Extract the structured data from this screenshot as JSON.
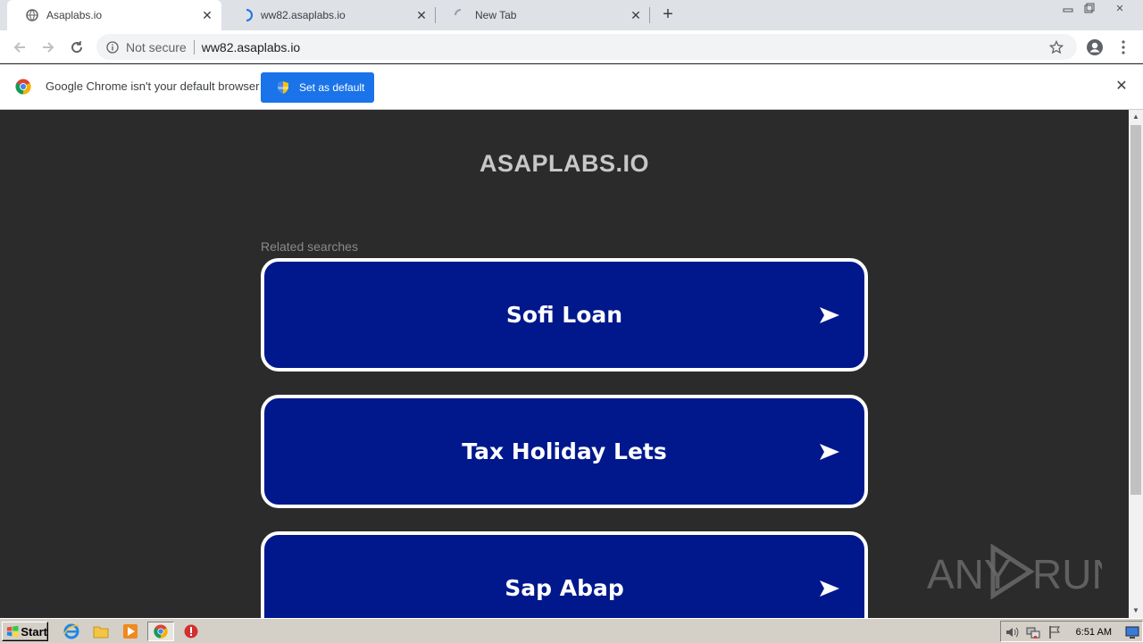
{
  "browser": {
    "tabs": [
      {
        "title": "Asaplabs.io",
        "active": true,
        "favicon": "globe-icon"
      },
      {
        "title": "ww82.asaplabs.io",
        "active": false,
        "favicon": "loading-icon"
      },
      {
        "title": "New Tab",
        "active": false,
        "favicon": "loading-icon"
      }
    ],
    "new_tab_label": "+",
    "omnibox": {
      "security_label": "Not secure",
      "url": "ww82.asaplabs.io"
    }
  },
  "infobar": {
    "message": "Google Chrome isn't your default browser",
    "button_label": "Set as default"
  },
  "page": {
    "site_title": "ASAPLABS.IO",
    "related_label": "Related searches",
    "searches": [
      "Sofi Loan",
      "Tax Holiday Lets",
      "Sap Abap"
    ],
    "button_color": "#00188c",
    "watermark": "ANY RUN"
  },
  "taskbar": {
    "start_label": "Start",
    "clock": "6:51 AM"
  }
}
